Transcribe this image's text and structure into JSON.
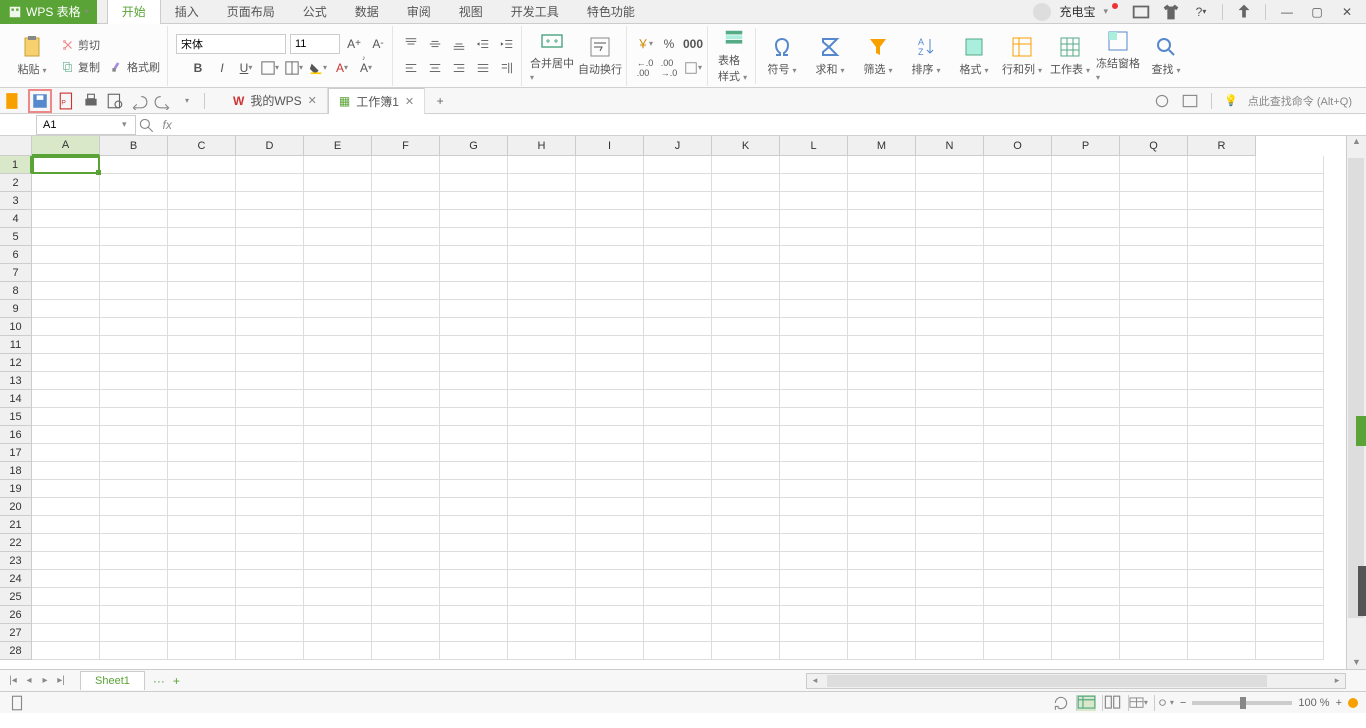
{
  "app": {
    "name": "WPS 表格"
  },
  "user": {
    "name": "充电宝"
  },
  "menu_tabs": [
    "开始",
    "插入",
    "页面布局",
    "公式",
    "数据",
    "审阅",
    "视图",
    "开发工具",
    "特色功能"
  ],
  "active_menu_tab": 0,
  "ribbon": {
    "paste": "粘贴",
    "cut": "剪切",
    "copy": "复制",
    "format_painter": "格式刷",
    "font_name": "宋体",
    "font_size": "11",
    "merge_center": "合并居中",
    "wrap_text": "自动换行",
    "currency": "￥",
    "percent": "%",
    "comma_fmt": ",",
    "inc_dec": ".00",
    "table_style": "表格样式",
    "symbol": "符号",
    "sum": "求和",
    "filter": "筛选",
    "sort": "排序",
    "format": "格式",
    "row_col": "行和列",
    "worksheet": "工作表",
    "freeze": "冻结窗格",
    "find": "查找"
  },
  "doc_tabs": [
    {
      "label": "我的WPS",
      "type": "w"
    },
    {
      "label": "工作簿1",
      "type": "s",
      "active": true
    }
  ],
  "search_hint": "点此查找命令 (Alt+Q)",
  "namebox": "A1",
  "columns": [
    "A",
    "B",
    "C",
    "D",
    "E",
    "F",
    "G",
    "H",
    "I",
    "J",
    "K",
    "L",
    "M",
    "N",
    "O",
    "P",
    "Q",
    "R"
  ],
  "row_count": 28,
  "active_cell": {
    "col": 0,
    "row": 0
  },
  "sheet": {
    "name": "Sheet1",
    "more": "···",
    "add": "+"
  },
  "status": {
    "zoom": "100 %"
  }
}
